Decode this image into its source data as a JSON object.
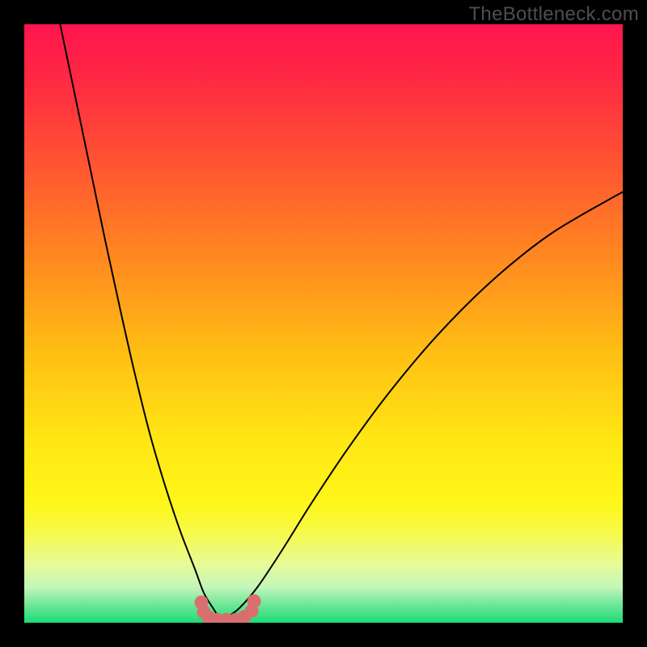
{
  "watermark": "TheBottleneck.com",
  "colors": {
    "gradient_stops": [
      {
        "offset": 0.0,
        "color": "#ff154e"
      },
      {
        "offset": 0.1,
        "color": "#ff2b42"
      },
      {
        "offset": 0.25,
        "color": "#ff5a30"
      },
      {
        "offset": 0.4,
        "color": "#ff8c1f"
      },
      {
        "offset": 0.55,
        "color": "#ffbf14"
      },
      {
        "offset": 0.7,
        "color": "#ffe814"
      },
      {
        "offset": 0.8,
        "color": "#fff61a"
      },
      {
        "offset": 0.85,
        "color": "#f6fa4a"
      },
      {
        "offset": 0.9,
        "color": "#e8fb95"
      },
      {
        "offset": 0.94,
        "color": "#c5f6ba"
      },
      {
        "offset": 0.97,
        "color": "#6ee798"
      },
      {
        "offset": 1.0,
        "color": "#1bdc76"
      }
    ],
    "curve": "#000000",
    "marker_fill": "#d96e6f",
    "marker_stroke": "none",
    "background_frame": "#000000"
  },
  "chart_data": {
    "type": "line",
    "title": "",
    "xlabel": "",
    "ylabel": "",
    "xlim": [
      0,
      100
    ],
    "ylim": [
      0,
      100
    ],
    "grid": false,
    "legend": false,
    "annotations": [
      "TheBottleneck.com"
    ],
    "series": [
      {
        "name": "left-branch",
        "x": [
          6.0,
          8.5,
          11.0,
          13.5,
          16.0,
          18.5,
          21.0,
          23.5,
          26.0,
          28.5,
          30.0,
          31.5,
          32.5,
          33.0
        ],
        "y": [
          100.0,
          88.0,
          76.0,
          64.0,
          52.5,
          41.5,
          31.5,
          23.0,
          15.5,
          9.0,
          5.0,
          2.5,
          1.0,
          0.5
        ]
      },
      {
        "name": "right-branch",
        "x": [
          33.0,
          34.0,
          36.0,
          39.0,
          43.0,
          48.0,
          54.0,
          61.0,
          69.0,
          78.0,
          88.0,
          100.0
        ],
        "y": [
          0.5,
          1.0,
          2.5,
          6.0,
          12.0,
          20.0,
          29.0,
          38.5,
          48.0,
          57.0,
          65.0,
          72.0
        ]
      }
    ],
    "markers": {
      "name": "bottleneck-points",
      "x": [
        29.6,
        30.0,
        30.8,
        32.3,
        33.8,
        35.3,
        36.8,
        38.0,
        38.4
      ],
      "y": [
        3.4,
        1.8,
        0.9,
        0.5,
        0.5,
        0.5,
        1.0,
        2.0,
        3.6
      ]
    }
  }
}
